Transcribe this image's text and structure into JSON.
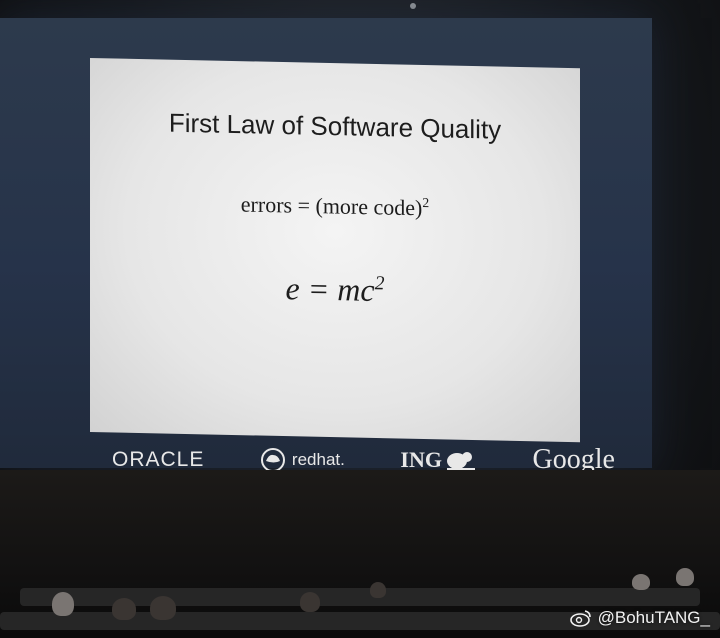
{
  "slide": {
    "title": "First Law of Software Quality",
    "formula1_base": "errors = (more code)",
    "formula1_exp": "2",
    "formula2_base": "e = mc",
    "formula2_exp": "2"
  },
  "sponsors": {
    "oracle": "ORACLE",
    "redhat": "redhat.",
    "ing": "ING",
    "google": "Google"
  },
  "watermark": {
    "handle": "@BohuTANG_"
  },
  "colors": {
    "screen_surround": "#26334a",
    "slide_background": "#ececec",
    "slide_text": "#1d1d1d",
    "logo_text": "#e8e8e8"
  }
}
